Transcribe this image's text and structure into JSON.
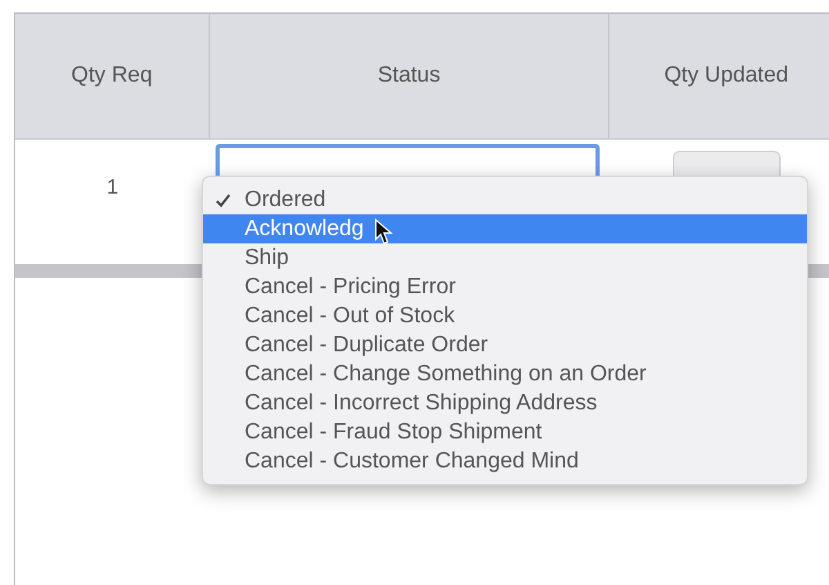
{
  "table": {
    "columns": [
      "Qty Req",
      "Status",
      "Qty Updated"
    ],
    "rows": [
      {
        "qty_req": "1"
      }
    ]
  },
  "status_menu": {
    "items": [
      {
        "label": "Ordered",
        "selected": true,
        "highlighted": false
      },
      {
        "label": "Acknowledg",
        "selected": false,
        "highlighted": true
      },
      {
        "label": "Ship",
        "selected": false,
        "highlighted": false
      },
      {
        "label": "Cancel - Pricing Error",
        "selected": false,
        "highlighted": false
      },
      {
        "label": "Cancel - Out of Stock",
        "selected": false,
        "highlighted": false
      },
      {
        "label": "Cancel - Duplicate Order",
        "selected": false,
        "highlighted": false
      },
      {
        "label": "Cancel - Change Something on an Order",
        "selected": false,
        "highlighted": false
      },
      {
        "label": "Cancel - Incorrect Shipping Address",
        "selected": false,
        "highlighted": false
      },
      {
        "label": "Cancel - Fraud Stop Shipment",
        "selected": false,
        "highlighted": false
      },
      {
        "label": "Cancel - Customer Changed Mind",
        "selected": false,
        "highlighted": false
      }
    ]
  }
}
